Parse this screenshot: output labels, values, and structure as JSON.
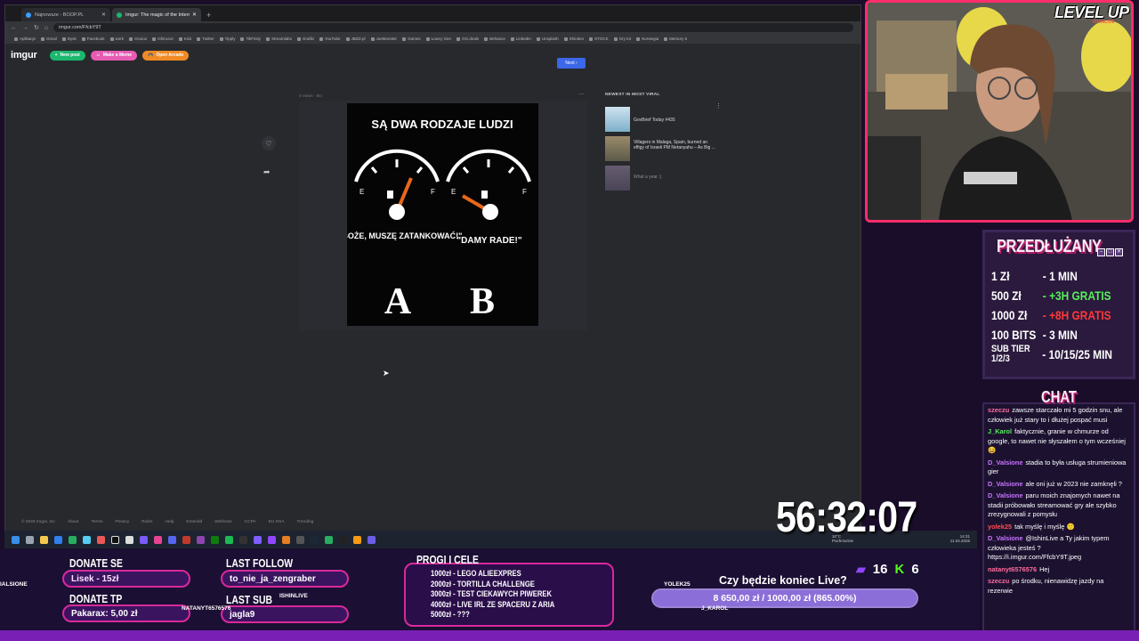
{
  "browser": {
    "tabs": [
      {
        "title": "Najnowsze - BOOP.PL",
        "active": false
      },
      {
        "title": "Imgur: The magic of the Internet",
        "active": true
      }
    ],
    "url": "imgur.com/FfcbY9T",
    "bookmarks": [
      "Aplikacje",
      "Gmail",
      "Dysk",
      "Facebook",
      "work",
      "Oculus",
      "IshinLive",
      "Kick",
      "Twitter",
      "Tipply",
      "TikFinity",
      "Streamlabs",
      "Grafiki",
      "YouTube",
      "JBZD.pl",
      "JoeMonster",
      "Games",
      "Łowcy Gier",
      "GG.deals",
      "Behance",
      "LinkedIn",
      "Unsplash",
      "Shinden",
      "STOCK",
      "Gry tnt",
      "Norwegia",
      "Memory 5"
    ]
  },
  "imgur": {
    "logo": "imgur",
    "new_post": "New post",
    "make_meme": "Make a Meme",
    "open_arcade": "Open Arcade",
    "next": "Next",
    "post_meta": "0 Views · 9m",
    "meme": {
      "title": "SĄ DWA RODZAJE LUDZI",
      "caption_a": "\"O BOŻE, MUSZĘ ZATANKOWAĆ!\"",
      "caption_b": "\"DAMY RADE!\"",
      "letter_a": "A",
      "letter_b": "B",
      "gauge_empty": "E",
      "gauge_full": "F"
    },
    "viral_heading": "NEWEST IN MOST VIRAL",
    "viral": [
      {
        "title": "GovBrief Today #435"
      },
      {
        "title": "Villagers in Malaga, Spain, burned an effigy of Israeli PM Netanyahu – As Big ..."
      },
      {
        "title": "What a year :)"
      }
    ],
    "footer": [
      "© 2026 Imgur, Inc",
      "About",
      "Terms",
      "Privacy",
      "Rules",
      "Help",
      "Emerald",
      "Wellness",
      "CCPA",
      "EU DSA",
      "Trending"
    ]
  },
  "taskbar": {
    "weather_temp": "10°C",
    "weather_desc": "Pochmurnie",
    "time": "14:31",
    "date": "11.04.2026"
  },
  "webcam": {
    "logo": "LEVEL UP",
    "logo_sub": "ISHINLIVE"
  },
  "extension": {
    "title": "PRZEDŁUŻANY",
    "rows": [
      {
        "left": "1 Zł",
        "right": "- 1 MIN",
        "color": "#ffffff"
      },
      {
        "left": "500 Zł",
        "right": "- +3H GRATIS",
        "color": "#56f05a"
      },
      {
        "left": "1000 Zł",
        "right": "- +8H GRATIS",
        "color": "#ff3a3a"
      },
      {
        "left": "100 BITS",
        "right": "- 3 MIN",
        "color": "#ffffff"
      },
      {
        "left": "SUB TIER 1/2/3",
        "right": "- 10/15/25 MIN",
        "color": "#ffffff"
      }
    ]
  },
  "chat": {
    "title": "CHAT",
    "messages": [
      {
        "user": "szeczu",
        "color": "#ff6b9e",
        "text": "zawsze starczało mi 5 godzin snu, ale człowiek już stary to i dłużej pospać musi"
      },
      {
        "user": "J_Karol",
        "color": "#56f05a",
        "text": "faktycznie, granie w chmurze od google, to nawet nie słyszałem o tym wcześniej 😄"
      },
      {
        "user": "D_Valsione",
        "color": "#c873ff",
        "text": "stadia to była usługa strumieniowa gier"
      },
      {
        "user": "D_Valsione",
        "color": "#c873ff",
        "text": "ale oni już w 2023 nie zamknęli ?"
      },
      {
        "user": "D_Valsione",
        "color": "#c873ff",
        "text": "paru moich znajomych nawet na stadii próbowało streamować gry ale szybko zrezygnowali z pomysłu"
      },
      {
        "user": "yolek25",
        "color": "#ff4d4d",
        "text": "tak myślę i myślę 🙂"
      },
      {
        "user": "D_Valsione",
        "color": "#c873ff",
        "text": "@IshinLive a Ty jakim typem człowieka jesteś ? https://i.imgur.com/FfcbY9T.jpeg"
      },
      {
        "user": "natanyt6576576",
        "color": "#ff6b9e",
        "text": "Hej"
      },
      {
        "user": "szeczu",
        "color": "#ff6b9e",
        "text": "po środku, nienawidzę jazdy na rezerwie"
      }
    ]
  },
  "overlay": {
    "donate_se_title": "DONATE SE",
    "donate_se_value": "Lisek - 15zł",
    "donate_tp_title": "DONATE TP",
    "donate_tp_value": "Pakarax: 5,00 zł",
    "last_follow_title": "LAST FOLLOW",
    "last_follow_value": "to_nie_ja_zengraber",
    "last_sub_title": "LAST SUB",
    "last_sub_value": "jagla9",
    "goals_title": "PROGI I CELE",
    "goals": [
      "1000zł - LEGO ALIEEXPRES",
      "2000zł - TORTILLA CHALLENGE",
      "3000zł - TEST CIEKAWYCH PIWEREK",
      "4000zł - LIVE IRL ZE SPACERU Z ARIA",
      "5000zł - ???"
    ],
    "end_question": "Czy będzie koniec Live?",
    "progress_text": "8 650,00 zł / 1000,00 zł (865.00%)",
    "progress_fraction": 1.0,
    "viewers": "16",
    "kick_count": "6",
    "timer": "56:32:07",
    "names": [
      "IALSIONE",
      "NATANYT6576576",
      "ISHINLIVE",
      "YOLEK25",
      "J_KAROL"
    ]
  }
}
